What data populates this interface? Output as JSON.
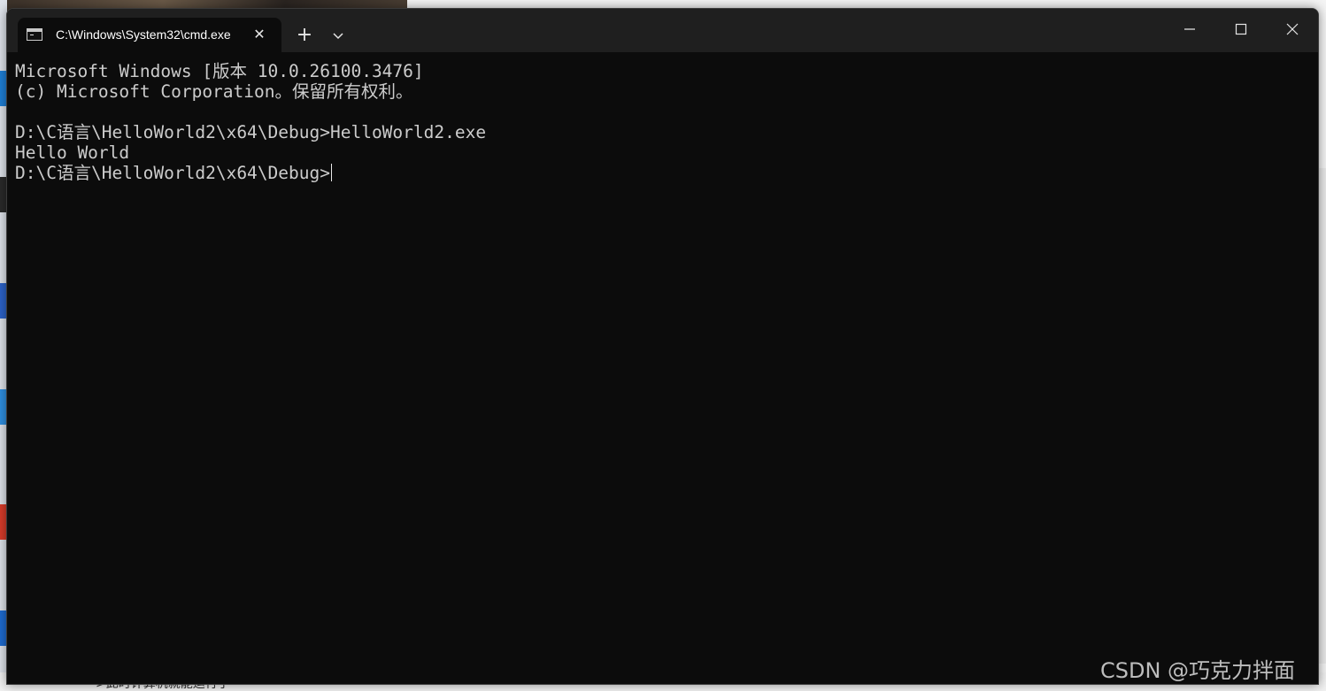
{
  "window": {
    "tab_title": "C:\\Windows\\System32\\cmd.exe",
    "tab_close_glyph": "✕",
    "new_tab_glyph": "+",
    "icons": {
      "tab": "console-icon",
      "dropdown": "chevron-down-icon",
      "minimize": "minimize-icon",
      "maximize": "maximize-icon",
      "close": "close-icon"
    }
  },
  "console": {
    "lines": [
      "Microsoft Windows [版本 10.0.26100.3476]",
      "(c) Microsoft Corporation。保留所有权利。",
      "",
      "D:\\C语言\\HelloWorld2\\x64\\Debug>HelloWorld2.exe",
      "Hello World",
      "D:\\C语言\\HelloWorld2\\x64\\Debug>"
    ]
  },
  "background": {
    "bottom_text": ">此时计算机就能运行了"
  },
  "watermark": "CSDN @巧克力拌面",
  "colors": {
    "console_bg": "#0c0c0c",
    "console_text": "#cccccc",
    "titlebar_bg": "#1f1f1f"
  }
}
